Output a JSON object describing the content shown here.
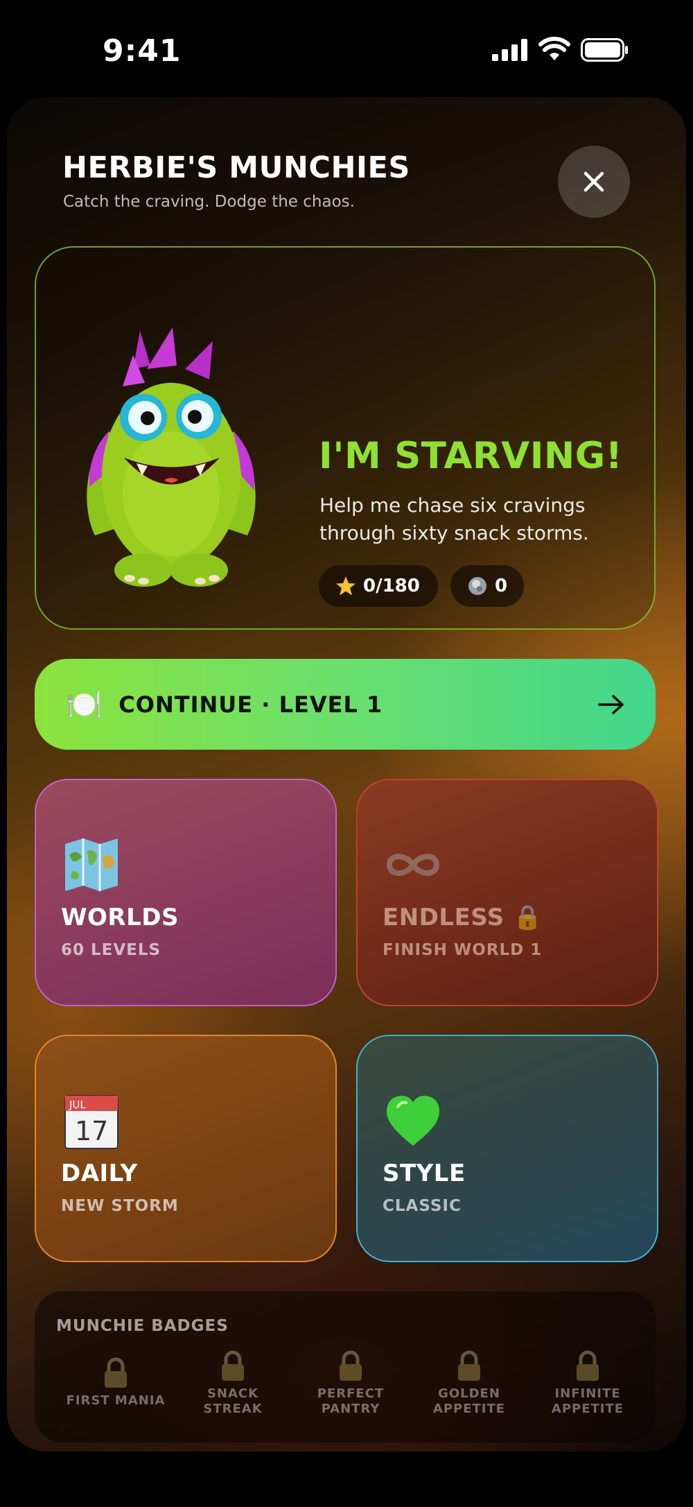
{
  "status_bar": {
    "time": "9:41"
  },
  "header": {
    "title": "HERBIE'S MUNCHIES",
    "subtitle": "Catch the craving. Dodge the chaos."
  },
  "hero": {
    "title": "I'M STARVING!",
    "text": "Help me chase six cravings through sixty snack storms.",
    "stars": "0/180",
    "coins": "0"
  },
  "continue_button": {
    "label": "CONTINUE · LEVEL 1",
    "icon": "🍽️"
  },
  "tiles": {
    "worlds": {
      "name": "WORLDS",
      "sub": "60 LEVELS",
      "icon": "map-icon"
    },
    "endless": {
      "name": "ENDLESS 🔒",
      "sub": "FINISH WORLD 1",
      "icon": "infinity-icon"
    },
    "daily": {
      "name": "DAILY",
      "sub": "NEW STORM",
      "icon": "calendar-icon",
      "calendar_month": "JUL",
      "calendar_day": "17"
    },
    "style": {
      "name": "STYLE",
      "sub": "CLASSIC",
      "icon": "green-heart-icon"
    }
  },
  "badges": {
    "title": "MUNCHIE BADGES",
    "items": [
      {
        "line1": "FIRST MANIA",
        "line2": ""
      },
      {
        "line1": "SNACK",
        "line2": "STREAK"
      },
      {
        "line1": "PERFECT",
        "line2": "PANTRY"
      },
      {
        "line1": "GOLDEN",
        "line2": "APPETITE"
      },
      {
        "line1": "INFINITE",
        "line2": "APPETITE"
      }
    ]
  },
  "colors": {
    "accent_green": "#8fe033",
    "continue_gradient_start": "#8be33c",
    "continue_gradient_end": "#43d68c"
  }
}
